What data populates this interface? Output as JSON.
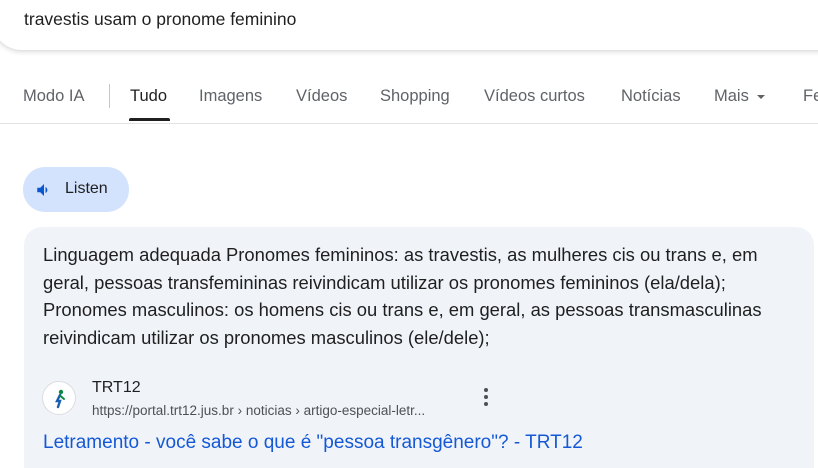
{
  "search": {
    "query": "travestis usam o pronome feminino"
  },
  "tabs": [
    {
      "label": "Modo IA"
    },
    {
      "label": "Tudo"
    },
    {
      "label": "Imagens"
    },
    {
      "label": "Vídeos"
    },
    {
      "label": "Shopping"
    },
    {
      "label": "Vídeos curtos"
    },
    {
      "label": "Notícias"
    },
    {
      "label": "Mais"
    },
    {
      "label": "Fe"
    }
  ],
  "active_tab": "Tudo",
  "listen": {
    "label": "Listen",
    "icon": "speaker-icon"
  },
  "answer": {
    "snippet": "Linguagem adequada Pronomes femininos: as travestis, as mulheres cis ou trans e, em geral, pessoas transfemininas reivindicam utilizar os pronomes femininos (ela/dela); Pronomes masculinos: os homens cis ou trans e, em geral, as pessoas transmasculinas reivindicam utilizar os pronomes masculinos (ele/dele);",
    "source": {
      "name": "TRT12",
      "url": "https://portal.trt12.jus.br › noticias › artigo-especial-letr...",
      "favicon": "trt12-logo-icon"
    },
    "link_title": "Letramento - você sabe o que é \"pessoa transgênero\"? - TRT12"
  },
  "colors": {
    "accent_link": "#1558d6",
    "listen_bg": "#d3e3fd",
    "card_bg": "#f0f4f9"
  }
}
